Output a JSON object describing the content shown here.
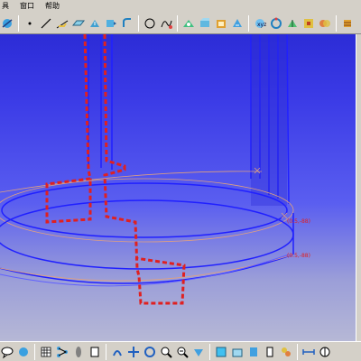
{
  "menu": {
    "items": [
      "具",
      "窗口",
      "帮助"
    ]
  },
  "annotations": {
    "right_top": "(0.5,-88)",
    "right_bottom": "(0.5,-88)",
    "left_mid": "",
    "left_bottom": ""
  },
  "colors": {
    "background_top": "#2c2cd6",
    "background_bottom": "#b6b8d6",
    "cylinder_edges": "#2020ff",
    "sketch_lines": "#e0a080",
    "dashed_profile": "#e02020"
  },
  "icons": {
    "top": [
      "compass-icon",
      "line-icon",
      "polyline-icon",
      "point-icon",
      "pad-icon",
      "pocket-icon",
      "shaft-icon",
      "circle-icon",
      "spline-icon",
      "fillet-icon",
      "chamfer-icon",
      "draft-icon",
      "shell-icon",
      "thickness-icon",
      "hole-icon",
      "thread-icon",
      "mirror-icon",
      "pattern-icon",
      "scale-icon",
      "boolean-icon"
    ],
    "bottom": [
      "comment-icon",
      "print-icon",
      "grid-icon",
      "tree-icon",
      "sketch-icon",
      "fly-icon",
      "pan-icon",
      "rotate-icon",
      "zoom-in-icon",
      "zoom-out-icon",
      "normal-view-icon",
      "iso-view-icon",
      "shading-icon",
      "hide-show-icon",
      "swap-icon",
      "measure-icon",
      "catalog-icon"
    ]
  }
}
